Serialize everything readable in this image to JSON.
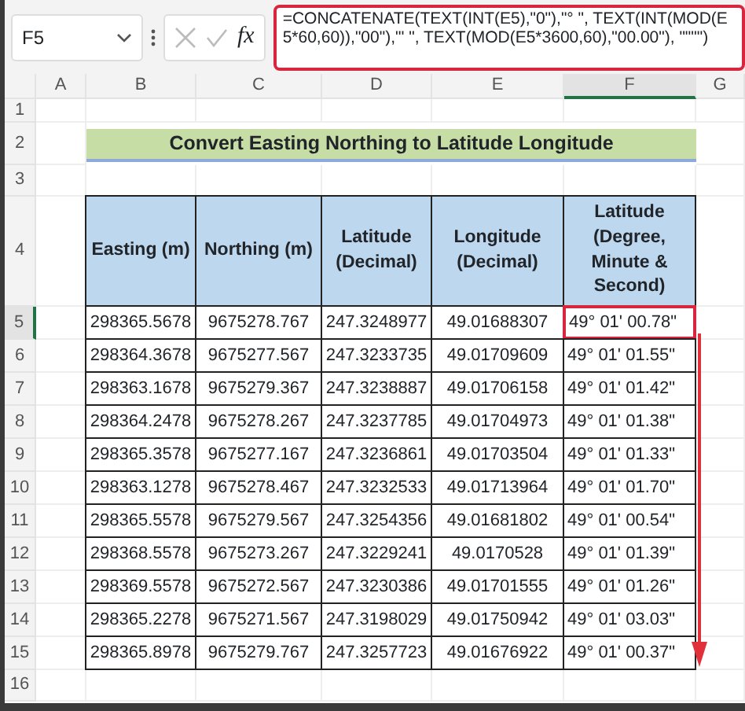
{
  "formula_bar": {
    "name_box": "F5",
    "function_label": "fx",
    "formula": "=CONCATENATE(TEXT(INT(E5),\"0\"),\"° \", TEXT(INT(MOD(E5*60,60)),\"00\"),\"' \", TEXT(MOD(E5*3600,60),\"00.00\"), \"\"\"\")"
  },
  "columns": [
    {
      "label": "A",
      "selected": false
    },
    {
      "label": "B",
      "selected": false
    },
    {
      "label": "C",
      "selected": false
    },
    {
      "label": "D",
      "selected": false
    },
    {
      "label": "E",
      "selected": false
    },
    {
      "label": "F",
      "selected": true
    },
    {
      "label": "G",
      "selected": false
    }
  ],
  "rows": [
    {
      "label": "1",
      "selected": false
    },
    {
      "label": "2",
      "selected": false
    },
    {
      "label": "3",
      "selected": false
    },
    {
      "label": "4",
      "selected": false
    },
    {
      "label": "5",
      "selected": true
    },
    {
      "label": "6",
      "selected": false
    },
    {
      "label": "7",
      "selected": false
    },
    {
      "label": "8",
      "selected": false
    },
    {
      "label": "9",
      "selected": false
    },
    {
      "label": "10",
      "selected": false
    },
    {
      "label": "11",
      "selected": false
    },
    {
      "label": "12",
      "selected": false
    },
    {
      "label": "13",
      "selected": false
    },
    {
      "label": "14",
      "selected": false
    },
    {
      "label": "15",
      "selected": false
    },
    {
      "label": "16",
      "selected": false
    }
  ],
  "sheet": {
    "title": "Convert Easting Northing to Latitude Longitude",
    "headers": [
      "Easting (m)",
      "Northing (m)",
      "Latitude (Decimal)",
      "Longitude (Decimal)",
      "Latitude (Degree, Minute & Second)"
    ],
    "records": [
      {
        "values": [
          "298365.5678",
          "9675278.767",
          "247.3248977",
          "49.01688307"
        ],
        "dms": "49° 01' 00.78\"",
        "highlighted": true
      },
      {
        "values": [
          "298364.3678",
          "9675277.567",
          "247.3233735",
          "49.01709609"
        ],
        "dms": "49° 01' 01.55\"",
        "highlighted": false
      },
      {
        "values": [
          "298363.1678",
          "9675279.367",
          "247.3238887",
          "49.01706158"
        ],
        "dms": "49° 01' 01.42\"",
        "highlighted": false
      },
      {
        "values": [
          "298364.2478",
          "9675278.267",
          "247.3237785",
          "49.01704973"
        ],
        "dms": "49° 01' 01.38\"",
        "highlighted": false
      },
      {
        "values": [
          "298365.3578",
          "9675277.167",
          "247.3236861",
          "49.01703504"
        ],
        "dms": "49° 01' 01.33\"",
        "highlighted": false
      },
      {
        "values": [
          "298363.1278",
          "9675278.467",
          "247.3232533",
          "49.01713964"
        ],
        "dms": "49° 01' 01.70\"",
        "highlighted": false
      },
      {
        "values": [
          "298365.5578",
          "9675279.567",
          "247.3254356",
          "49.01681802"
        ],
        "dms": "49° 01' 00.54\"",
        "highlighted": false
      },
      {
        "values": [
          "298368.5578",
          "9675273.267",
          "247.3229241",
          "49.0170528"
        ],
        "dms": "49° 01' 01.39\"",
        "highlighted": false
      },
      {
        "values": [
          "298369.5578",
          "9675272.567",
          "247.3230386",
          "49.01701555"
        ],
        "dms": "49° 01' 01.26\"",
        "highlighted": false
      },
      {
        "values": [
          "298365.2278",
          "9675271.567",
          "247.3198029",
          "49.01750942"
        ],
        "dms": "49° 01' 03.03\"",
        "highlighted": false
      },
      {
        "values": [
          "298365.8978",
          "9675279.767",
          "247.3257723",
          "49.01676922"
        ],
        "dms": "49° 01' 00.37\"",
        "highlighted": false
      }
    ]
  }
}
